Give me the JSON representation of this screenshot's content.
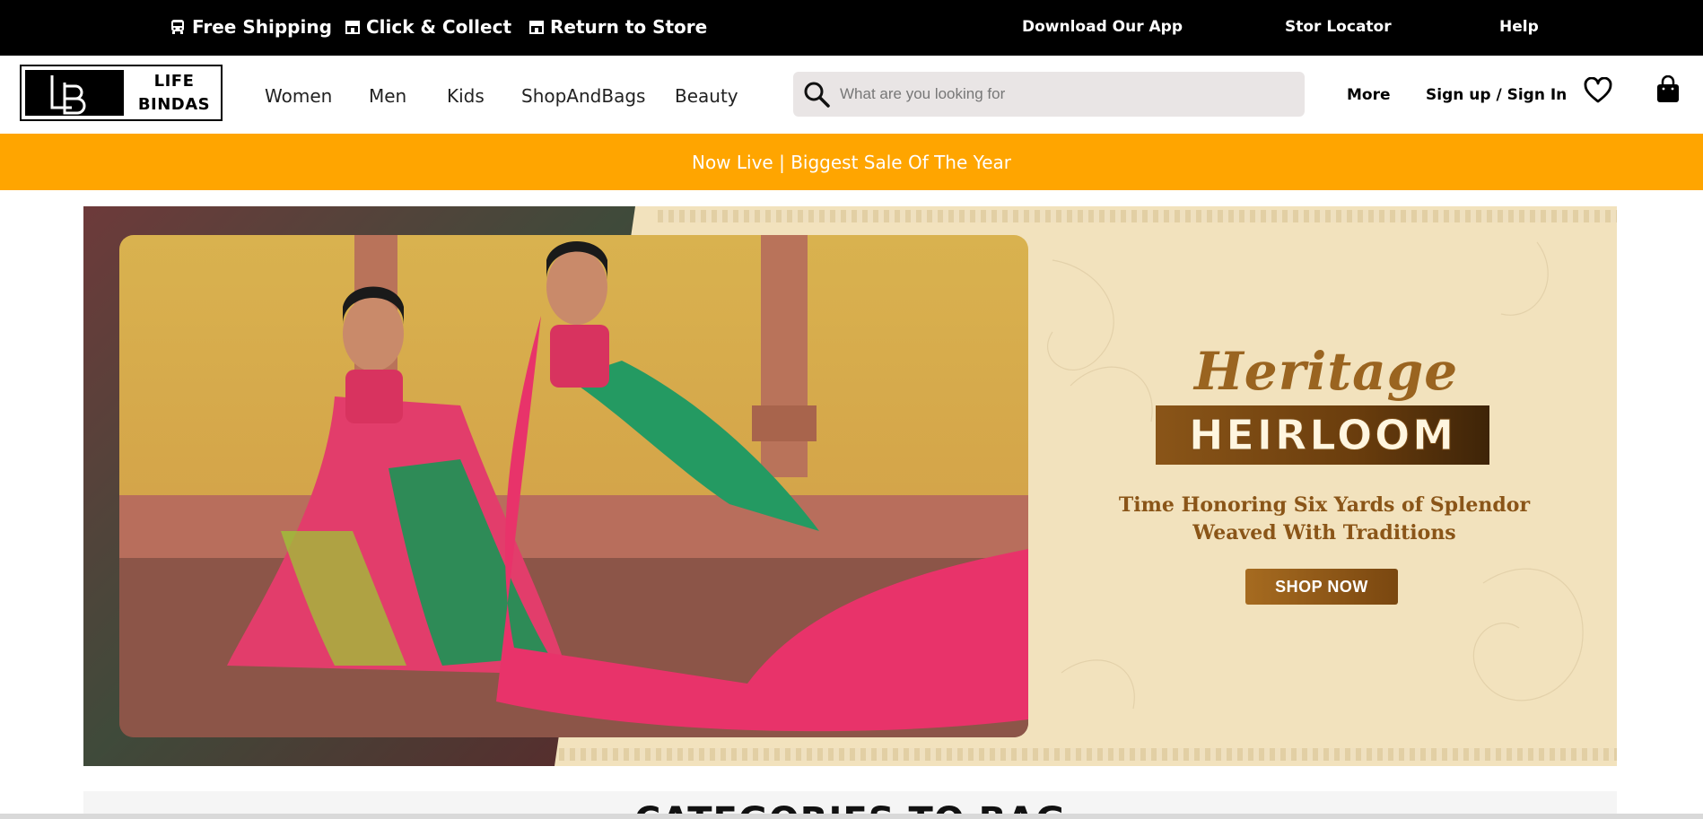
{
  "topbar": {
    "perks": [
      "Free Shipping",
      "Click & Collect",
      "Return to Store"
    ],
    "links": [
      "Download Our App",
      "Stor Locator",
      "Help"
    ]
  },
  "logo": {
    "line1": "LIFE",
    "line2": "BINDAS"
  },
  "menu": [
    "Women",
    "Men",
    "Kids",
    "ShopAndBags",
    "Beauty"
  ],
  "search": {
    "placeholder": "What are you looking for",
    "value": ""
  },
  "nav": {
    "more": "More",
    "signin": "Sign up / Sign In"
  },
  "promo": {
    "text": "Now Live | Biggest Sale Of The Year"
  },
  "hero": {
    "title_script": "Heritage",
    "title_block": "HEIRLOOM",
    "tagline_1": "Time Honoring Six Yards of Splendor",
    "tagline_2": "Weaved With Traditions",
    "cta": "SHOP NOW"
  },
  "section": {
    "title": "CATEGORIES TO BAG"
  },
  "colors": {
    "topbar": "#000000",
    "promo": "#ffa500",
    "search_bg": "#e9e5e5",
    "hero_bg": "#f2e2bd",
    "brown": "#8a5518"
  },
  "icons": [
    "bus-icon",
    "store-icon",
    "store-icon",
    "search-icon",
    "heart-icon",
    "bag-icon"
  ]
}
